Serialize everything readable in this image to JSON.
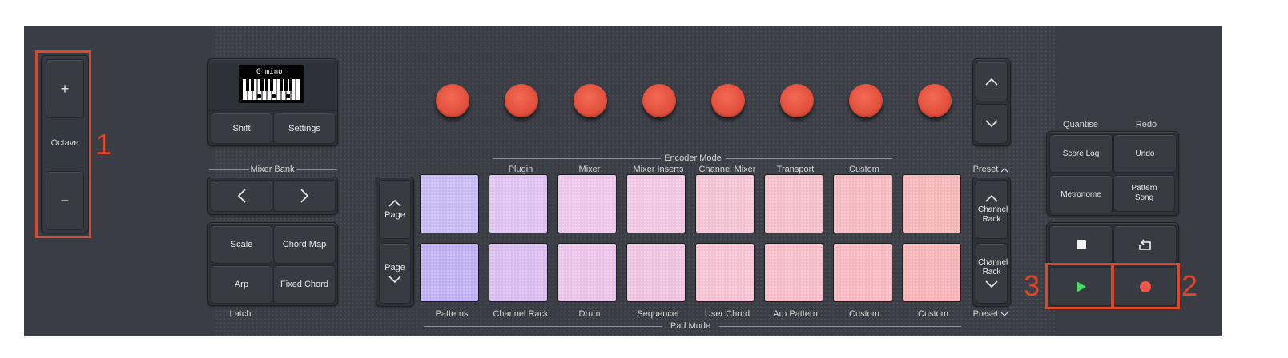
{
  "octave": {
    "plus": "+",
    "minus": "–",
    "label": "Octave"
  },
  "screen": {
    "text": "G minor"
  },
  "display_buttons": {
    "shift": "Shift",
    "settings": "Settings"
  },
  "mixer_bank": {
    "label": "Mixer Bank"
  },
  "scale_group": {
    "scale": "Scale",
    "chord_map": "Chord Map",
    "arp": "Arp",
    "fixed_chord": "Fixed Chord",
    "latch": "Latch"
  },
  "page": {
    "up": "Page",
    "down": "Page"
  },
  "encoder_mode": {
    "label": "Encoder Mode",
    "items": [
      "Plugin",
      "Mixer",
      "Mixer Inserts",
      "Channel Mixer",
      "Transport",
      "Custom"
    ]
  },
  "pad_mode": {
    "label": "Pad Mode",
    "items": [
      "Patterns",
      "Channel Rack",
      "Drum",
      "Sequencer",
      "User Chord",
      "Arp Pattern",
      "Custom",
      "Custom"
    ]
  },
  "pads": {
    "top_colors": [
      "#c6b8f2",
      "#ddc1f0",
      "#edc4ea",
      "#f0c5e2",
      "#f3c2d3",
      "#f5bdc6",
      "#f6b8bf",
      "#f7b5b8"
    ],
    "bottom_colors": [
      "#bfaef0",
      "#d9bcef",
      "#ebc2ea",
      "#efc3e0",
      "#f3c1d1",
      "#f5bcc5",
      "#f6b7be",
      "#f7b3b6"
    ]
  },
  "right_side": {
    "preset_top": "Preset",
    "channel_rack_up": "Channel Rack",
    "channel_rack_down": "Channel Rack",
    "preset_bottom": "Preset"
  },
  "function_group": {
    "quantise": "Quantise",
    "redo": "Redo",
    "score_log": "Score Log",
    "undo": "Undo",
    "metronome": "Metronome",
    "pattern_song": "Pattern Song"
  },
  "annotations": {
    "one": "1",
    "two": "2",
    "three": "3"
  },
  "colors": {
    "knob": "#e65a45",
    "annotation": "#e0472a",
    "play": "#4cd964",
    "record": "#f0574a"
  }
}
